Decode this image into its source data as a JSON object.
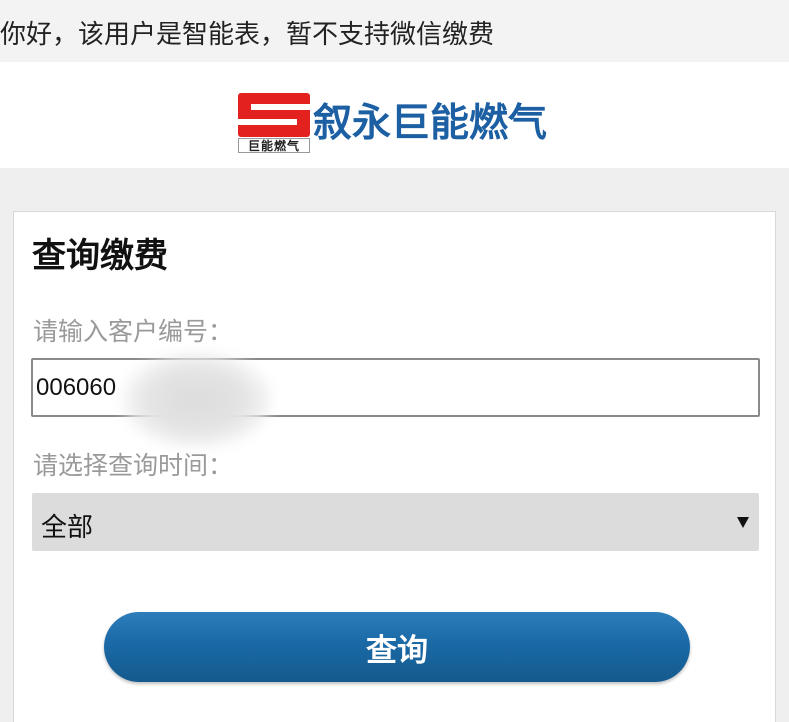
{
  "notice": {
    "text": "你好，该用户是智能表，暂不支持微信缴费"
  },
  "brand": {
    "name": "叙永巨能燃气",
    "logo_text": "巨能燃气",
    "logo_icon": "company-logo-icon"
  },
  "card": {
    "title": "查询缴费",
    "customer_no": {
      "label": "请输入客户编号：",
      "value": "006060"
    },
    "query_time": {
      "label": "请选择查询时间：",
      "selected": "全部",
      "icon": "triangle-down-icon"
    },
    "submit_label": "查询"
  },
  "colors": {
    "brand_blue": "#1c5fa3",
    "logo_red": "#e3211e",
    "button_blue": "#1a69a6"
  }
}
